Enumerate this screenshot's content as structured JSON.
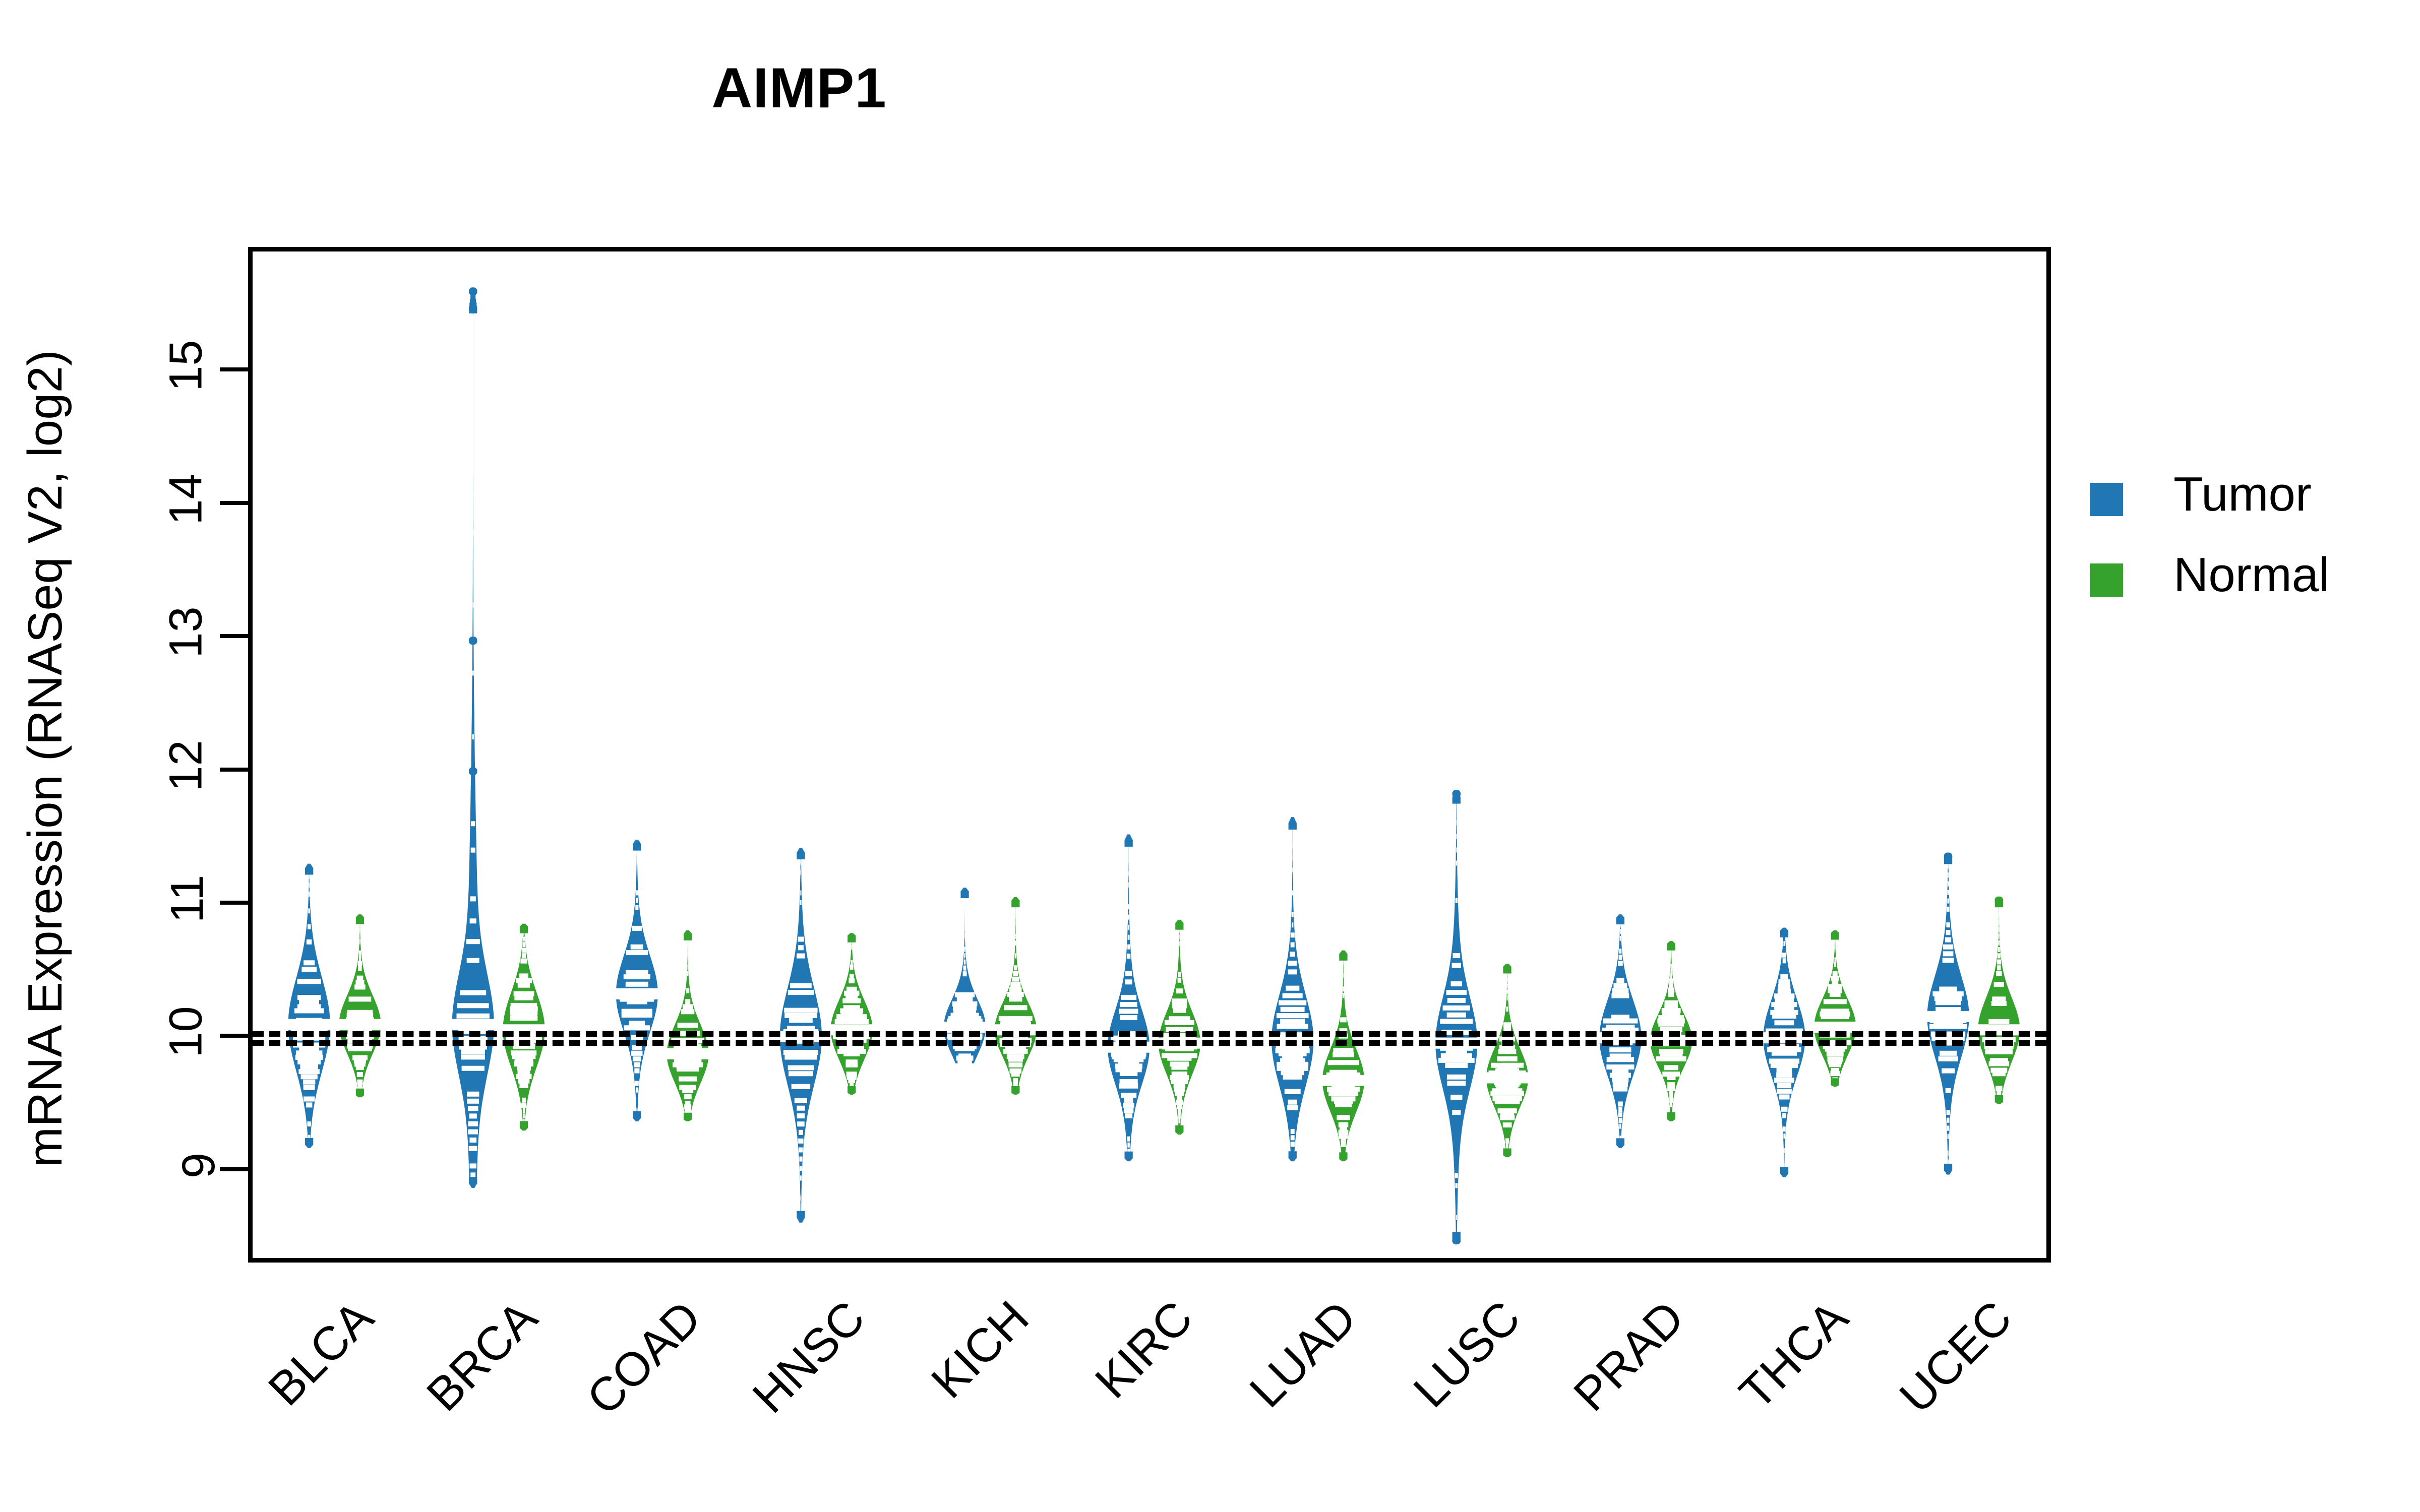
{
  "chart_data": {
    "type": "violin",
    "title": "AIMP1",
    "xlabel": "",
    "ylabel": "mRNA Expression (RNASeq V2, log2)",
    "ylim": [
      8.3,
      15.92
    ],
    "yticks": [
      9,
      10,
      11,
      12,
      13,
      14,
      15
    ],
    "ytick_labels": [
      "9",
      "10",
      "11",
      "12",
      "13",
      "14",
      "15"
    ],
    "grid": false,
    "legend_position": "right",
    "reference_lines": [
      10.07,
      10.0
    ],
    "categories": [
      "BLCA",
      "BRCA",
      "COAD",
      "HNSC",
      "KICH",
      "KIRC",
      "LUAD",
      "LUSC",
      "PRAD",
      "THCA",
      "UCEC"
    ],
    "series": [
      {
        "name": "Tumor",
        "color": "#2077b4",
        "medians": [
          10.12,
          10.12,
          10.35,
          10.03,
          10.1,
          9.95,
          10.0,
          9.98,
          10.02,
          10.02,
          10.18
        ],
        "q_low": [
          9.8,
          9.78,
          10.1,
          9.72,
          9.92,
          9.72,
          9.7,
          9.68,
          9.78,
          9.78,
          9.9
        ],
        "q_high": [
          10.45,
          10.48,
          10.62,
          10.38,
          10.3,
          10.22,
          10.32,
          10.3,
          10.3,
          10.3,
          10.45
        ],
        "min": [
          9.22,
          8.92,
          9.42,
          8.66,
          9.82,
          9.12,
          9.12,
          8.5,
          9.22,
          9.0,
          9.02
        ],
        "max": [
          11.3,
          15.62,
          11.48,
          11.42,
          11.12,
          11.52,
          11.65,
          11.85,
          10.92,
          10.82,
          11.38
        ],
        "outliers": [
          [],
          [
            15.62,
            13.0,
            12.02
          ],
          [],
          [],
          [],
          [],
          [],
          [
            11.85,
            8.5
          ],
          [],
          [],
          [
            11.38
          ]
        ]
      },
      {
        "name": "Normal",
        "color": "#35a22e",
        "medians": [
          10.12,
          10.08,
          9.9,
          10.08,
          10.08,
          9.98,
          9.7,
          9.72,
          10.0,
          10.1,
          10.08
        ],
        "q_low": [
          9.92,
          9.82,
          9.7,
          9.88,
          9.92,
          9.78,
          9.52,
          9.55,
          9.82,
          9.92,
          9.88
        ],
        "q_high": [
          10.32,
          10.35,
          10.1,
          10.3,
          10.28,
          10.2,
          9.95,
          9.95,
          10.18,
          10.32,
          10.32
        ],
        "min": [
          9.6,
          9.35,
          9.42,
          9.62,
          9.62,
          9.32,
          9.12,
          9.15,
          9.42,
          9.68,
          9.55
        ],
        "max": [
          10.92,
          10.85,
          10.8,
          10.78,
          11.05,
          10.88,
          10.65,
          10.55,
          10.72,
          10.8,
          11.05
        ],
        "outliers": [
          [],
          [],
          [],
          [],
          [],
          [],
          [],
          [],
          [],
          [],
          [
            11.05
          ]
        ]
      }
    ]
  },
  "legend": {
    "items": [
      {
        "label": "Tumor",
        "color": "#2077b4"
      },
      {
        "label": "Normal",
        "color": "#35a22e"
      }
    ]
  }
}
